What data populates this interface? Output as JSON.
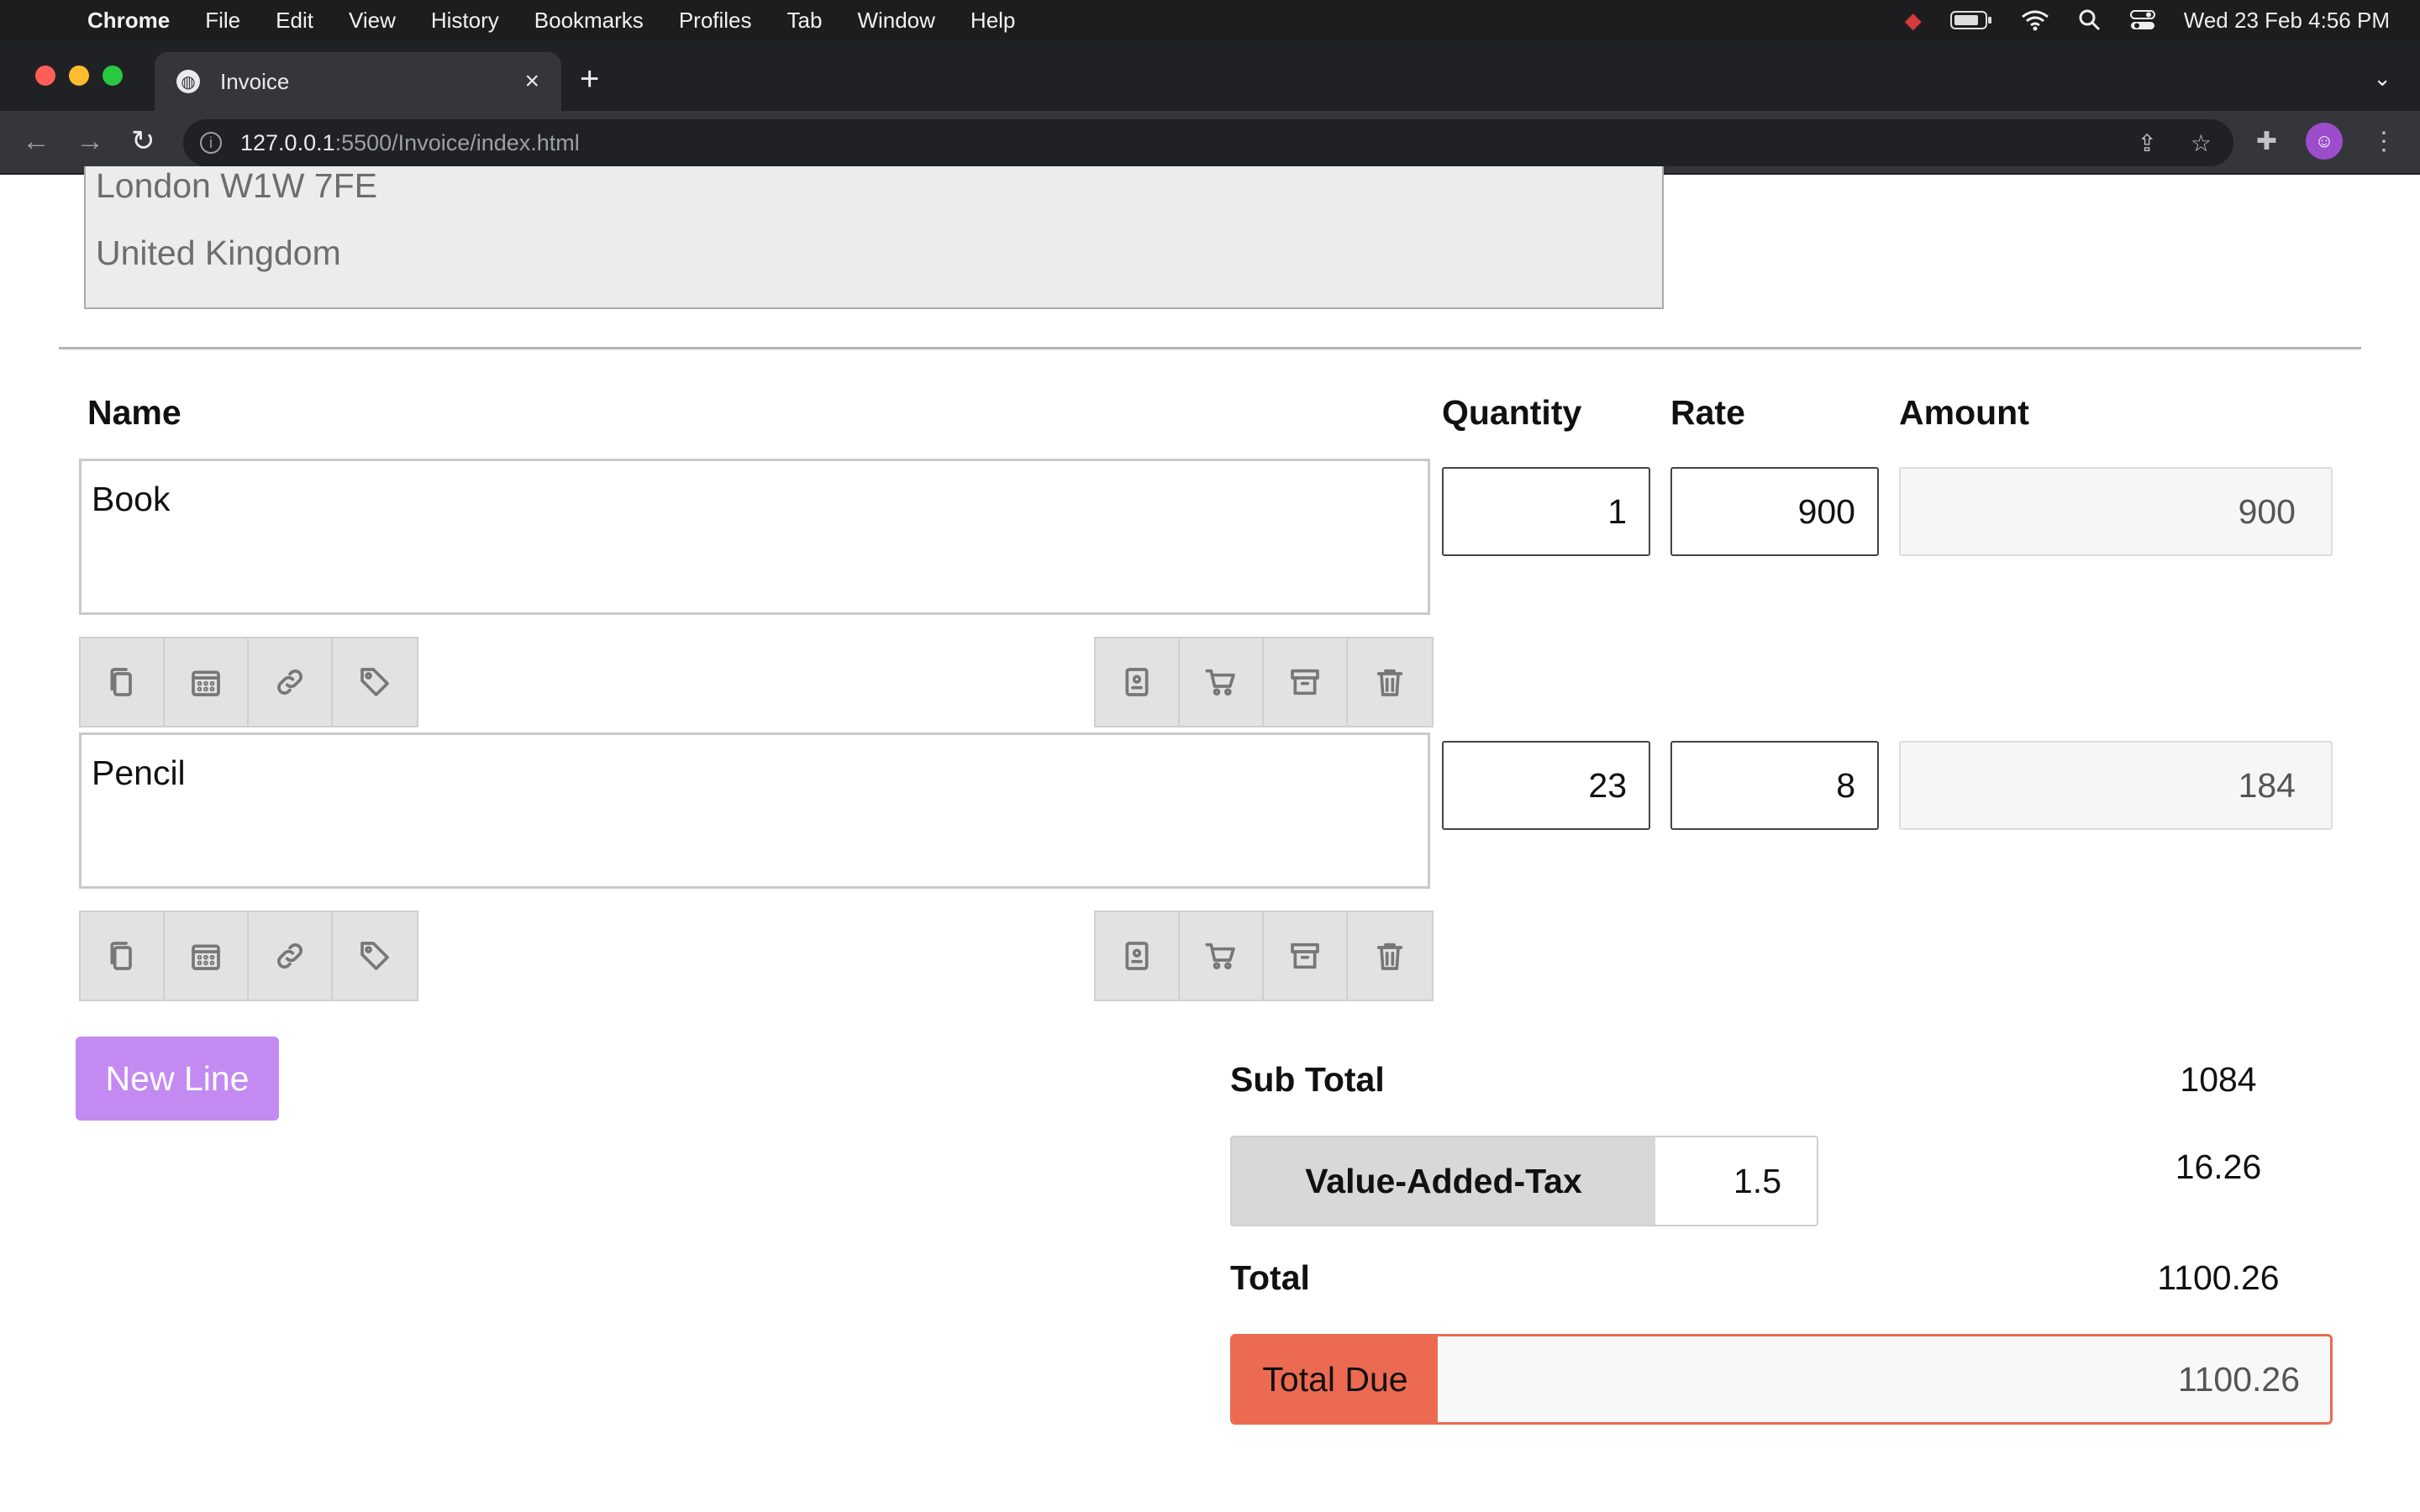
{
  "menubar": {
    "app": "Chrome",
    "items": [
      "File",
      "Edit",
      "View",
      "History",
      "Bookmarks",
      "Profiles",
      "Tab",
      "Window",
      "Help"
    ],
    "clock": "Wed 23 Feb  4:56 PM"
  },
  "browser": {
    "tab_title": "Invoice",
    "url_host": "127.0.0.1",
    "url_path": ":5500/Invoice/index.html"
  },
  "address": {
    "line1": "London W1W 7FE",
    "line2": "United Kingdom"
  },
  "columns": {
    "name": "Name",
    "quantity": "Quantity",
    "rate": "Rate",
    "amount": "Amount"
  },
  "lines": [
    {
      "name": "Book",
      "quantity": "1",
      "rate": "900",
      "amount": "900"
    },
    {
      "name": "Pencil",
      "quantity": "23",
      "rate": "8",
      "amount": "184"
    }
  ],
  "line_actions_left": [
    "copy-icon",
    "calendar-icon",
    "link-icon",
    "tag-icon"
  ],
  "line_actions_right": [
    "contact-card-icon",
    "cart-icon",
    "archive-icon",
    "trash-icon"
  ],
  "new_line_label": "New Line",
  "totals": {
    "subtotal_label": "Sub Total",
    "subtotal_value": "1084",
    "vat_label": "Value-Added-Tax",
    "vat_rate": "1.5",
    "vat_value": "16.26",
    "total_label": "Total",
    "total_value": "1100.26",
    "due_label": "Total Due",
    "due_value": "1100.26"
  },
  "colors": {
    "new_line_button": "#c38af2",
    "total_due_accent": "#ec6a52"
  }
}
